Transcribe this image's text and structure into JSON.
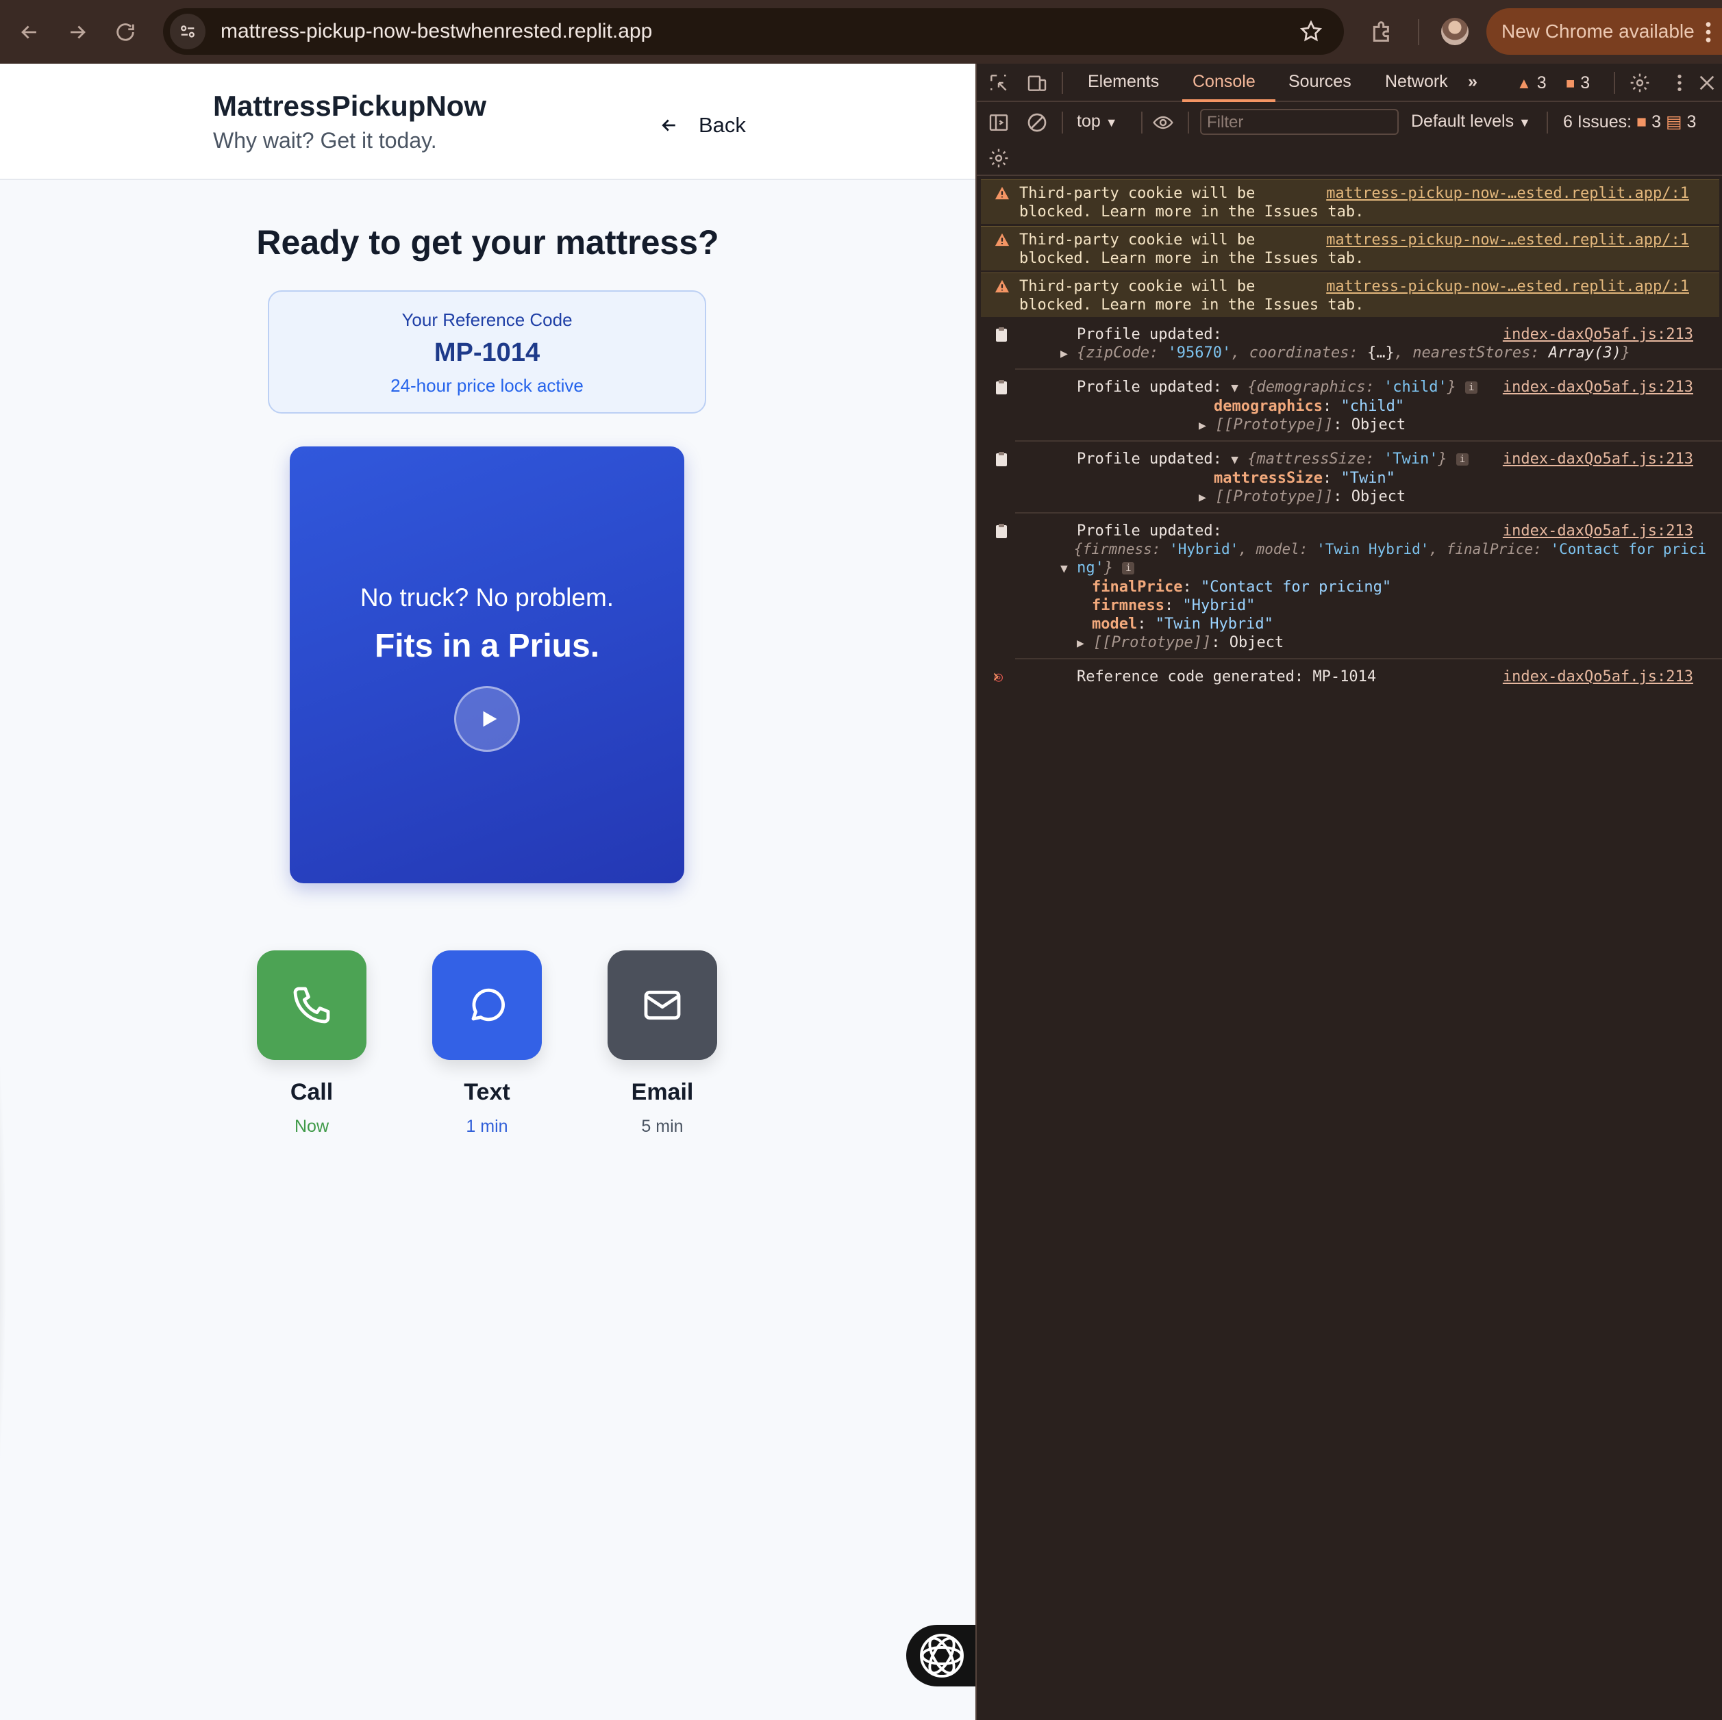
{
  "browser": {
    "url": "mattress-pickup-now-bestwhenrested.replit.app",
    "update_label": "New Chrome available"
  },
  "site": {
    "brand": "MattressPickupNow",
    "tagline": "Why wait? Get it today.",
    "back_label": "Back"
  },
  "main": {
    "heading": "Ready to get your mattress?",
    "reference": {
      "label": "Your Reference Code",
      "code": "MP-1014",
      "note": "24-hour price lock active"
    },
    "video": {
      "line1": "No truck? No problem.",
      "line2": "Fits in a Prius."
    },
    "contact_options": [
      {
        "label": "Call",
        "eta": "Now",
        "color": "#4ca354",
        "eta_color": "#3f9a48",
        "icon": "phone-icon"
      },
      {
        "label": "Text",
        "eta": "1 min",
        "color": "#3361e6",
        "eta_color": "#2f5ed8",
        "icon": "chat-bubble-icon"
      },
      {
        "label": "Email",
        "eta": "5 min",
        "color": "#4b505b",
        "eta_color": "#4b5563",
        "icon": "mail-icon"
      }
    ]
  },
  "devtools": {
    "tabs": [
      "Elements",
      "Console",
      "Sources",
      "Network"
    ],
    "active_tab": "Console",
    "warn_count": "3",
    "error_count": "3",
    "context": "top",
    "filter_placeholder": "Filter",
    "levels": "Default levels",
    "issues_label": "6 Issues:",
    "issues_warn": "3",
    "issues_info": "3",
    "warnings": [
      {
        "l1": "Third-party cookie will be",
        "l2": "blocked. Learn more in the Issues tab.",
        "src": "mattress-pickup-now-…ested.replit.app/:1"
      },
      {
        "l1": "Third-party cookie will be",
        "l2": "blocked. Learn more in the Issues tab.",
        "src": "mattress-pickup-now-…ested.replit.app/:1"
      },
      {
        "l1": "Third-party cookie will be",
        "l2": "blocked. Learn more in the Issues tab.",
        "src": "mattress-pickup-now-…ested.replit.app/:1"
      }
    ],
    "log_src": "index-daxQo5af.js:213",
    "log1": {
      "title": "Profile updated:",
      "k1": "zipCode",
      "v1": "'95670'",
      "k2": "coordinates",
      "v2": "{…}",
      "k3": "nearestStores",
      "v3": "Array(3)"
    },
    "log2": {
      "title": "Profile updated:",
      "summary_key": "demographics",
      "summary_val": "'child'",
      "prop_key": "demographics",
      "prop_val": "\"child\"",
      "proto": "[[Prototype]]",
      "proto_val": "Object"
    },
    "log3": {
      "title": "Profile updated:",
      "summary_key": "mattressSize",
      "summary_val": "'Twin'",
      "prop_key": "mattressSize",
      "prop_val": "\"Twin\"",
      "proto": "[[Prototype]]",
      "proto_val": "Object"
    },
    "log4": {
      "title": "Profile updated:",
      "k1": "firmness",
      "v1": "'Hybrid'",
      "k2": "model",
      "v2": "'Twin Hybrid'",
      "k3": "finalPrice",
      "v3a": "'Contact for prici",
      "v3b": "ng'",
      "p1k": "finalPrice",
      "p1v": "\"Contact for pricing\"",
      "p2k": "firmness",
      "p2v": "\"Hybrid\"",
      "p3k": "model",
      "p3v": "\"Twin Hybrid\"",
      "proto": "[[Prototype]]",
      "proto_val": "Object"
    },
    "log5": {
      "text": "Reference code generated: MP-1014"
    }
  }
}
